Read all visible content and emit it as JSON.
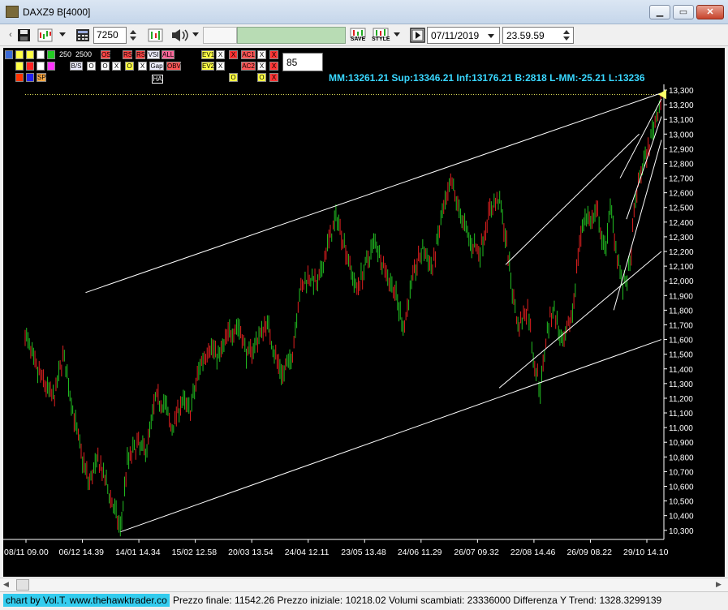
{
  "window": {
    "title": "DAXZ9 B[4000]",
    "minimize_icon": "minimize-icon",
    "maximize_icon": "maximize-icon",
    "close_icon": "close-icon"
  },
  "toolbar": {
    "ticks_value": "7250",
    "save_label": "SAVE",
    "style_label": "STYLE",
    "date_value": "07/11/2019",
    "time_value": "23.59.59"
  },
  "chart_panel": {
    "counter_a": "250",
    "counter_b": "2500",
    "param_value": "85",
    "buttons_row1": [
      "OS",
      "RS",
      "RS",
      "VSI",
      "ALL",
      "EV1",
      "X",
      "AC1",
      "X"
    ],
    "buttons_row2": [
      "B/S",
      "O",
      "O",
      "X",
      "O",
      "X",
      "Gap",
      "OBV",
      "EV2",
      "X",
      "AC2",
      "X"
    ],
    "buttons_row3": [
      "HA"
    ],
    "buttons_left": [
      "SP"
    ],
    "stats": "MM:13261.21 Sup:13346.21 Inf:13176.21 B:2818 L-MM:-25.21 L:13236"
  },
  "chart_data": {
    "type": "line",
    "title": "",
    "xlabel": "",
    "ylabel": "",
    "ylim": [
      10260,
      13300
    ],
    "yticks": [
      10300,
      10400,
      10500,
      10600,
      10700,
      10800,
      10900,
      11000,
      11100,
      11200,
      11300,
      11400,
      11500,
      11600,
      11700,
      11800,
      11900,
      12000,
      12100,
      12200,
      12300,
      12400,
      12500,
      12600,
      12700,
      12800,
      12900,
      13000,
      13100,
      13200,
      13300
    ],
    "x_tick_labels": [
      "08/11 09.00",
      "06/12 14.39",
      "14/01 14.34",
      "15/02 12.58",
      "20/03 13.54",
      "24/04 12.11",
      "23/05 13.48",
      "24/06 11.29",
      "26/07 09.32",
      "22/08 14.46",
      "26/09 08.22",
      "29/10 14.10"
    ],
    "x_range": [
      0,
      100
    ],
    "series_colors": {
      "up": "#22c022",
      "down": "#e02020",
      "trend": "#ffffff",
      "level": "#ffff66"
    },
    "price_path": [
      [
        0,
        11640
      ],
      [
        1.5,
        11420
      ],
      [
        3,
        11300
      ],
      [
        4.5,
        11190
      ],
      [
        6,
        11500
      ],
      [
        7.5,
        11120
      ],
      [
        8.5,
        10880
      ],
      [
        10,
        10620
      ],
      [
        11.5,
        10780
      ],
      [
        13,
        10580
      ],
      [
        14,
        10440
      ],
      [
        15,
        10300
      ],
      [
        16,
        10760
      ],
      [
        17.5,
        10880
      ],
      [
        19,
        10840
      ],
      [
        20.5,
        11200
      ],
      [
        22,
        11160
      ],
      [
        23,
        10980
      ],
      [
        24.5,
        11180
      ],
      [
        26,
        11120
      ],
      [
        27.5,
        11430
      ],
      [
        29,
        11560
      ],
      [
        30.5,
        11480
      ],
      [
        32,
        11640
      ],
      [
        33.5,
        11700
      ],
      [
        35,
        11480
      ],
      [
        36.5,
        11600
      ],
      [
        38,
        11720
      ],
      [
        39.5,
        11460
      ],
      [
        40.5,
        11360
      ],
      [
        42,
        11500
      ],
      [
        43,
        11900
      ],
      [
        44.5,
        12040
      ],
      [
        46,
        11960
      ],
      [
        47.5,
        12240
      ],
      [
        49,
        12440
      ],
      [
        50.5,
        12200
      ],
      [
        52,
        11940
      ],
      [
        53.5,
        12100
      ],
      [
        55,
        12280
      ],
      [
        56.5,
        12080
      ],
      [
        58,
        11940
      ],
      [
        59.5,
        11680
      ],
      [
        61,
        12040
      ],
      [
        62.5,
        12220
      ],
      [
        64,
        12080
      ],
      [
        65.5,
        12440
      ],
      [
        67,
        12660
      ],
      [
        68.5,
        12440
      ],
      [
        70,
        12260
      ],
      [
        71.5,
        12200
      ],
      [
        73,
        12480
      ],
      [
        74.5,
        12560
      ],
      [
        75.5,
        12300
      ],
      [
        76.5,
        11960
      ],
      [
        77.5,
        11680
      ],
      [
        79,
        11820
      ],
      [
        80,
        11440
      ],
      [
        81,
        11260
      ],
      [
        82,
        11660
      ],
      [
        83,
        11820
      ],
      [
        84.5,
        11540
      ],
      [
        86,
        11780
      ],
      [
        87,
        12220
      ],
      [
        88,
        12460
      ],
      [
        89,
        12400
      ],
      [
        90,
        12460
      ],
      [
        91,
        12180
      ],
      [
        92,
        12500
      ],
      [
        93,
        12200
      ],
      [
        94,
        11940
      ],
      [
        95,
        12080
      ],
      [
        96,
        12580
      ],
      [
        97,
        12780
      ],
      [
        98,
        12900
      ],
      [
        99,
        13100
      ],
      [
        100,
        13240
      ]
    ],
    "trend_lines": [
      {
        "from": [
          9.5,
          11920
        ],
        "to": [
          100,
          13280
        ]
      },
      {
        "from": [
          15,
          10290
        ],
        "to": [
          100,
          11600
        ]
      },
      {
        "from": [
          75.5,
          12110
        ],
        "to": [
          96.5,
          13000
        ]
      },
      {
        "from": [
          74.5,
          11270
        ],
        "to": [
          100,
          12200
        ]
      },
      {
        "from": [
          92.5,
          11800
        ],
        "to": [
          100,
          12960
        ]
      },
      {
        "from": [
          93.5,
          12700
        ],
        "to": [
          100,
          13240
        ]
      },
      {
        "from": [
          94.5,
          12420
        ],
        "to": [
          100,
          13120
        ]
      }
    ],
    "level_line": 13270,
    "grid": false,
    "legend": "none"
  },
  "status": {
    "credit": "chart by Vol.T. www.thehawktrader.co",
    "summary": "Prezzo finale: 11542.26 Prezzo iniziale: 10218.02 Volumi scambiati: 23336000 Differenza Y Trend: 1328.3299139"
  }
}
